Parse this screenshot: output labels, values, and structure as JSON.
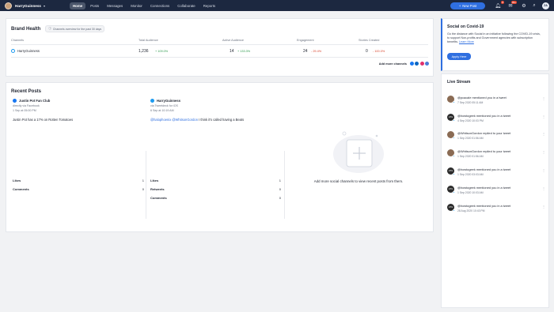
{
  "topbar": {
    "account_name": "HarryGuinness",
    "nav": [
      "Home",
      "Posts",
      "Messages",
      "Monitor",
      "Connections",
      "Collaborate",
      "Reports"
    ],
    "new_post_label": "New Post",
    "notifications_badge": "8",
    "messages_badge": "99+",
    "user_initials": "ZA",
    "accent": "#2f6fe0"
  },
  "brand_health": {
    "title": "Brand Health",
    "overview_pill": "Channels overview for the past 30 days",
    "headers": {
      "channels": "Channels",
      "total_audience": "Total Audience",
      "active_audience": "Active Audience",
      "engagement": "Engagement",
      "stories_created": "Stories Created"
    },
    "row": {
      "channel": "HarryGuinness",
      "total_audience": "1,236",
      "total_change": "+ 109.0%",
      "active_audience": "14",
      "active_change": "+ 133.3%",
      "engagement": "24",
      "engagement_change": "- 29.4%",
      "stories_created": "0",
      "stories_change": "- 100.0%"
    },
    "add_more_label": "Add more channels",
    "social_colors": [
      "#1877f2",
      "#0a66c2",
      "#e1306c",
      "#4c7bd9"
    ]
  },
  "recent_posts": {
    "title": "Recent Posts",
    "posts": [
      {
        "author": "Justin Pot Fan Club",
        "via": "directly via Facebook",
        "time": "1 Sep at 05:00 PM",
        "text_plain": "Justin Pot has a 17% on Rotten Tomatoes",
        "stats": [
          {
            "label": "Likes",
            "value": "1"
          },
          {
            "label": "Comments",
            "value": "0"
          }
        ]
      },
      {
        "author": "HarryGuinness",
        "via": "via Tweetdeck for iOS",
        "time": "6 Sep at 10:19 AM",
        "mention_1": "@halophoenix",
        "mention_2": "@WhitsonGordon",
        "text_rest": " I think it's called having a Beats",
        "stats": [
          {
            "label": "Likes",
            "value": "1"
          },
          {
            "label": "Retweets",
            "value": "0"
          },
          {
            "label": "Comments",
            "value": "0"
          }
        ]
      }
    ],
    "add_channels_text": "Add more social channels to view recent posts from them."
  },
  "social_covid": {
    "title": "Social on Covid-19",
    "body": "Go the distance with Social in an initiative following the COVID-19 crisis, to support Non-profits and Government agencies with subscription benefits.",
    "learn_more": "Learn More",
    "apply_label": "Apply Here"
  },
  "live_stream": {
    "title": "Live Stream",
    "items": [
      {
        "avatar": "",
        "message": "@pcacale mentioned you in a tweet",
        "time": "7 Sep 2020 05:11 AM"
      },
      {
        "avatar": "HTG",
        "message": "@howtogeek mentioned you in a tweet",
        "time": "4 Sep 2020 10:03 PM"
      },
      {
        "avatar": "",
        "message": "@WhitsonGordon replied to your tweet",
        "time": "1 Sep 2020 01:56 AM"
      },
      {
        "avatar": "",
        "message": "@WhitsonGordon replied to your tweet",
        "time": "1 Sep 2020 01:56 AM"
      },
      {
        "avatar": "HTG",
        "message": "@howtogeek mentioned you in a tweet",
        "time": "1 Sep 2020 03:03 AM"
      },
      {
        "avatar": "HTG",
        "message": "@howtogeek mentioned you in a tweet",
        "time": "1 Sep 2020 10:03 AM"
      },
      {
        "avatar": "HTG",
        "message": "@howtogeek mentioned you in a tweet",
        "time": "28 Aug 2020 10:43 PM"
      }
    ]
  }
}
